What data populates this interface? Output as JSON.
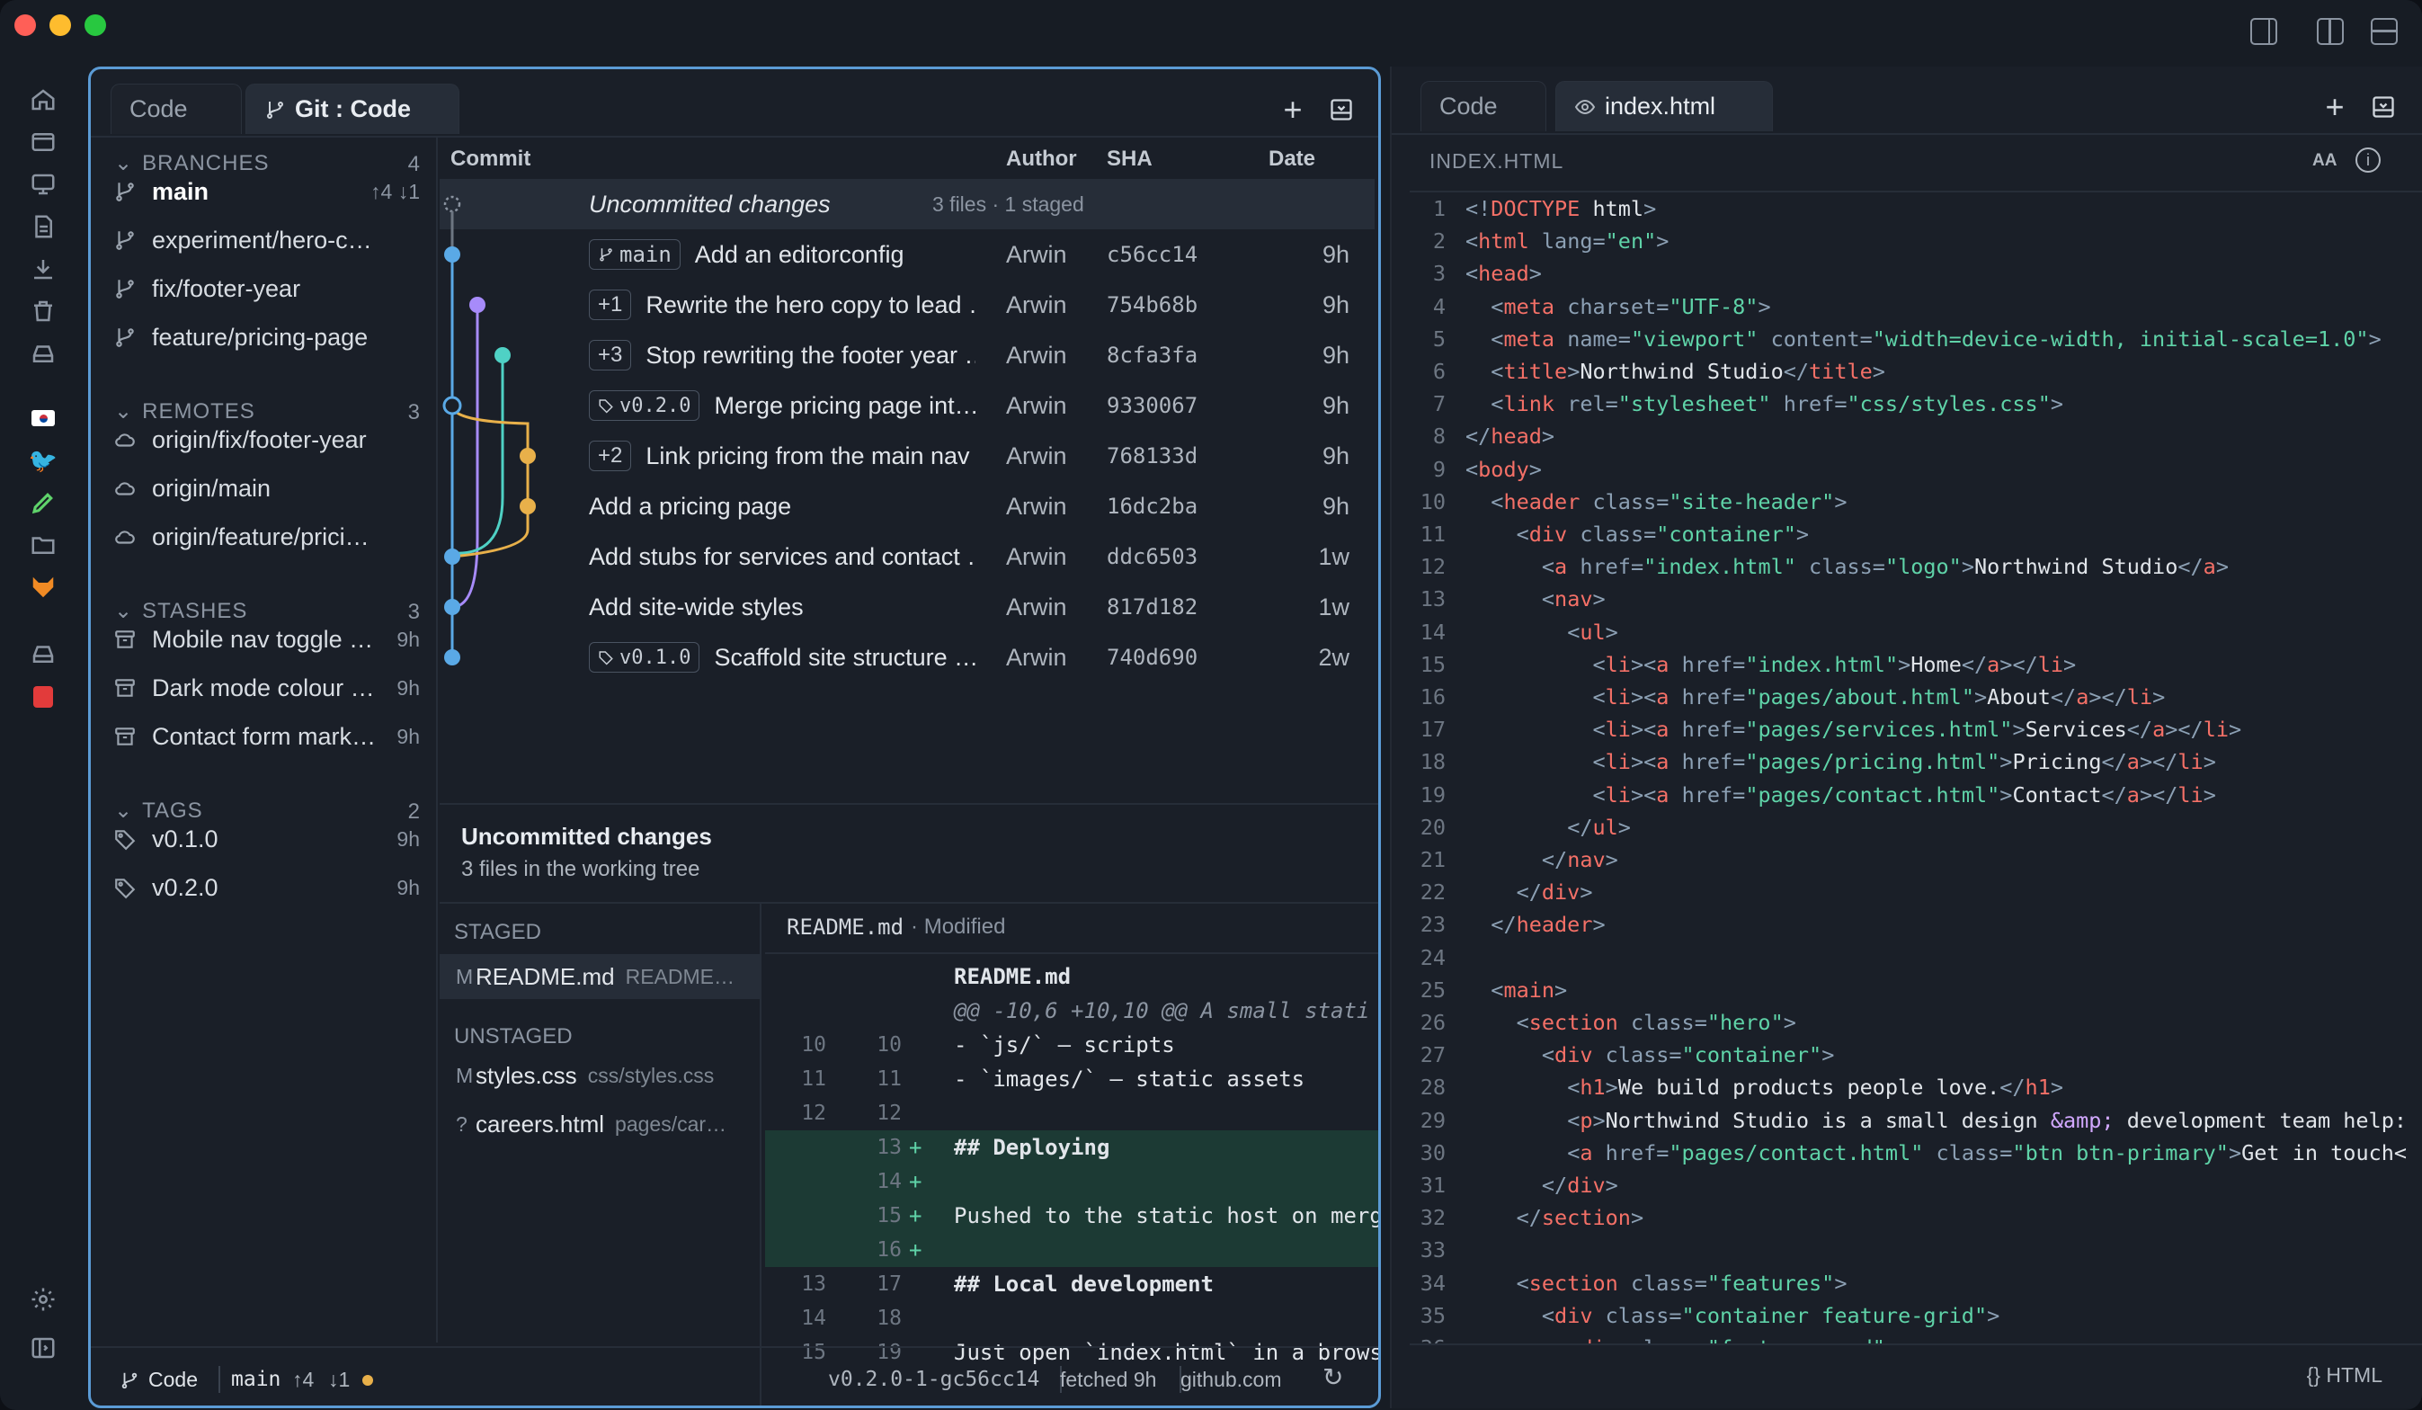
{
  "window": {
    "title": "Git : Code"
  },
  "left_tabs": [
    {
      "label": "Code"
    },
    {
      "label": "Git : Code"
    }
  ],
  "right_tabs": [
    {
      "label": "Code"
    },
    {
      "label": "index.html"
    }
  ],
  "sidebar": {
    "branches": {
      "label": "BRANCHES",
      "count": "4",
      "items": [
        {
          "name": "main",
          "meta": "↑4 ↓1"
        },
        {
          "name": "experiment/hero-copy",
          "meta": ""
        },
        {
          "name": "fix/footer-year",
          "meta": ""
        },
        {
          "name": "feature/pricing-page",
          "meta": ""
        }
      ]
    },
    "remotes": {
      "label": "REMOTES",
      "count": "3",
      "items": [
        {
          "name": "origin/fix/footer-year"
        },
        {
          "name": "origin/main"
        },
        {
          "name": "origin/feature/pricing-…"
        }
      ]
    },
    "stashes": {
      "label": "STASHES",
      "count": "3",
      "items": [
        {
          "name": "Mobile nav toggle (…",
          "meta": "9h"
        },
        {
          "name": "Dark mode colour s…",
          "meta": "9h"
        },
        {
          "name": "Contact form mark…",
          "meta": "9h"
        }
      ]
    },
    "tags": {
      "label": "TAGS",
      "count": "2",
      "items": [
        {
          "name": "v0.1.0",
          "meta": "9h"
        },
        {
          "name": "v0.2.0",
          "meta": "9h"
        }
      ]
    }
  },
  "commit_table": {
    "headers": {
      "commit": "Commit",
      "author": "Author",
      "sha": "SHA",
      "date": "Date"
    },
    "uncommitted": {
      "label": "Uncommitted changes",
      "meta": "3 files · 1 staged"
    },
    "rows": [
      {
        "chip": "main",
        "message": "Add an editorconfig",
        "author": "Arwin",
        "sha": "c56cc14",
        "date": "9h"
      },
      {
        "chip": "+1",
        "message": "Rewrite the hero copy to lead …",
        "author": "Arwin",
        "sha": "754b68b",
        "date": "9h"
      },
      {
        "chip": "+3",
        "message": "Stop rewriting the footer year …",
        "author": "Arwin",
        "sha": "8cfa3fa",
        "date": "9h"
      },
      {
        "chip": "v0.2.0",
        "message": "Merge pricing page int…",
        "author": "Arwin",
        "sha": "9330067",
        "date": "9h"
      },
      {
        "chip": "+2",
        "message": "Link pricing from the main nav",
        "author": "Arwin",
        "sha": "768133d",
        "date": "9h"
      },
      {
        "chip": "",
        "message": "Add a pricing page",
        "author": "Arwin",
        "sha": "16dc2ba",
        "date": "9h"
      },
      {
        "chip": "",
        "message": "Add stubs for services and contact …",
        "author": "Arwin",
        "sha": "ddc6503",
        "date": "1w"
      },
      {
        "chip": "",
        "message": "Add site-wide styles",
        "author": "Arwin",
        "sha": "817d182",
        "date": "1w"
      },
      {
        "chip": "v0.1.0",
        "message": "Scaffold site structure …",
        "author": "Arwin",
        "sha": "740d690",
        "date": "2w"
      }
    ]
  },
  "detail": {
    "title": "Uncommitted changes",
    "subtitle": "3 files in the working tree",
    "staged_label": "STAGED",
    "unstaged_label": "UNSTAGED",
    "staged": [
      {
        "status": "M",
        "name": "README.md",
        "path": "README…"
      }
    ],
    "unstaged": [
      {
        "status": "M",
        "name": "styles.css",
        "path": "css/styles.css"
      },
      {
        "status": "?",
        "name": "careers.html",
        "path": "pages/car…"
      }
    ],
    "diff_file": "README.md",
    "diff_status": "· Modified",
    "diff_lines": [
      {
        "o": "",
        "n": "",
        "p": "",
        "c": "README.md",
        "kind": "header"
      },
      {
        "o": "",
        "n": "",
        "p": "",
        "c": "@@ -10,6 +10,10 @@ A small stati",
        "kind": "hunk"
      },
      {
        "o": "10",
        "n": "10",
        "p": "",
        "c": "- `js/` — scripts",
        "kind": "ctx"
      },
      {
        "o": "11",
        "n": "11",
        "p": "",
        "c": "- `images/` — static assets",
        "kind": "ctx"
      },
      {
        "o": "12",
        "n": "12",
        "p": "",
        "c": "",
        "kind": "ctx"
      },
      {
        "o": "",
        "n": "13",
        "p": "+",
        "c": "## Deploying",
        "kind": "add"
      },
      {
        "o": "",
        "n": "14",
        "p": "+",
        "c": "",
        "kind": "add"
      },
      {
        "o": "",
        "n": "15",
        "p": "+",
        "c": "Pushed to the static host on merg",
        "kind": "add"
      },
      {
        "o": "",
        "n": "16",
        "p": "+",
        "c": "",
        "kind": "add"
      },
      {
        "o": "13",
        "n": "17",
        "p": "",
        "c": "## Local development",
        "kind": "ctx-bold"
      },
      {
        "o": "14",
        "n": "18",
        "p": "",
        "c": "",
        "kind": "ctx"
      },
      {
        "o": "15",
        "n": "19",
        "p": "",
        "c": "Just open `index.html` in a brows",
        "kind": "ctx"
      }
    ]
  },
  "status_bar": {
    "mode": "Code",
    "branch": "main",
    "ahead": "↑4",
    "behind": "↓1",
    "describe": "v0.2.0-1-gc56cc14",
    "fetched": "fetched 9h",
    "host": "github.com"
  },
  "editor": {
    "file_label": "INDEX.HTML",
    "font_btn": "AA",
    "language": "{} HTML",
    "lines": [
      "<!DOCTYPE html>",
      "<html lang=\"en\">",
      "<head>",
      "  <meta charset=\"UTF-8\">",
      "  <meta name=\"viewport\" content=\"width=device-width, initial-scale=1.0\">",
      "  <title>Northwind Studio</title>",
      "  <link rel=\"stylesheet\" href=\"css/styles.css\">",
      "</head>",
      "<body>",
      "  <header class=\"site-header\">",
      "    <div class=\"container\">",
      "      <a href=\"index.html\" class=\"logo\">Northwind Studio</a>",
      "      <nav>",
      "        <ul>",
      "          <li><a href=\"index.html\">Home</a></li>",
      "          <li><a href=\"pages/about.html\">About</a></li>",
      "          <li><a href=\"pages/services.html\">Services</a></li>",
      "          <li><a href=\"pages/pricing.html\">Pricing</a></li>",
      "          <li><a href=\"pages/contact.html\">Contact</a></li>",
      "        </ul>",
      "      </nav>",
      "    </div>",
      "  </header>",
      "",
      "  <main>",
      "    <section class=\"hero\">",
      "      <div class=\"container\">",
      "        <h1>We build products people love.</h1>",
      "        <p>Northwind Studio is a small design &amp; development team help:",
      "        <a href=\"pages/contact.html\" class=\"btn btn-primary\">Get in touch<",
      "      </div>",
      "    </section>",
      "",
      "    <section class=\"features\">",
      "      <div class=\"container feature-grid\">",
      "        <div class=\"feature-card\">"
    ]
  },
  "colors": {
    "accent": "#5b9bd5",
    "graph_blue": "#5aa9e6",
    "graph_purple": "#a78bfa",
    "graph_teal": "#4fd1c5",
    "graph_orange": "#e8b04a"
  }
}
